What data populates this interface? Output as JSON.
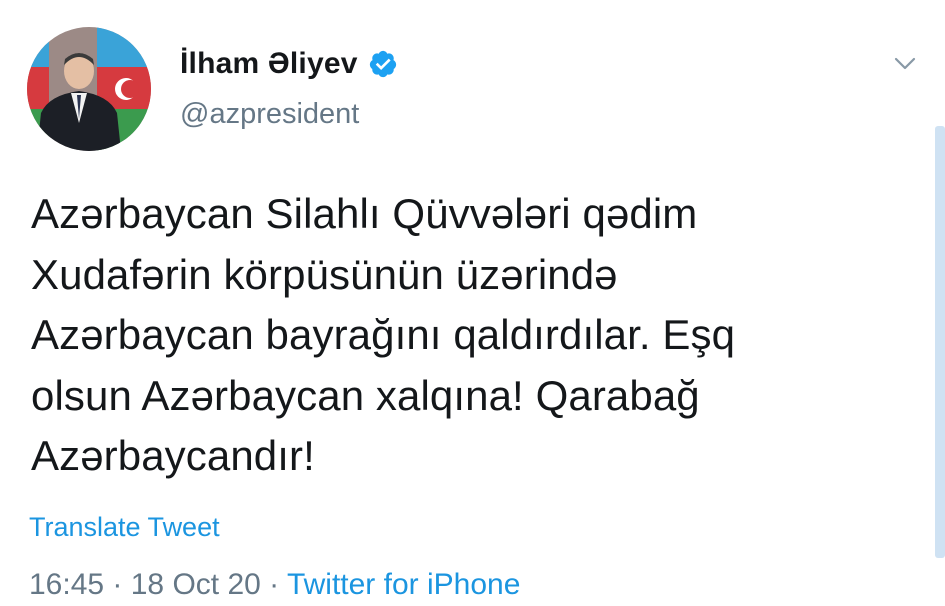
{
  "tweet": {
    "author": {
      "display_name": "İlham Əliyev",
      "handle": "@azpresident",
      "verified": true
    },
    "text": "Azərbaycan Silahlı Qüvvələri qədim\nXudafərin körpüsünün üzərində\nAzərbaycan bayrağını qaldırdılar. Eşq\nolsun Azərbaycan xalqına! Qarabağ\nAzərbaycandır!",
    "translate_label": "Translate Tweet",
    "time": "16:45",
    "date": "18 Oct 20",
    "separator": " · ",
    "source": "Twitter for iPhone"
  },
  "colors": {
    "link_blue": "#1b95e0",
    "verified_blue": "#1da1f2",
    "muted_gray": "#657786",
    "text_dark": "#14171a"
  },
  "icons": {
    "menu": "chevron-down-icon",
    "badge": "verified-badge-icon"
  }
}
